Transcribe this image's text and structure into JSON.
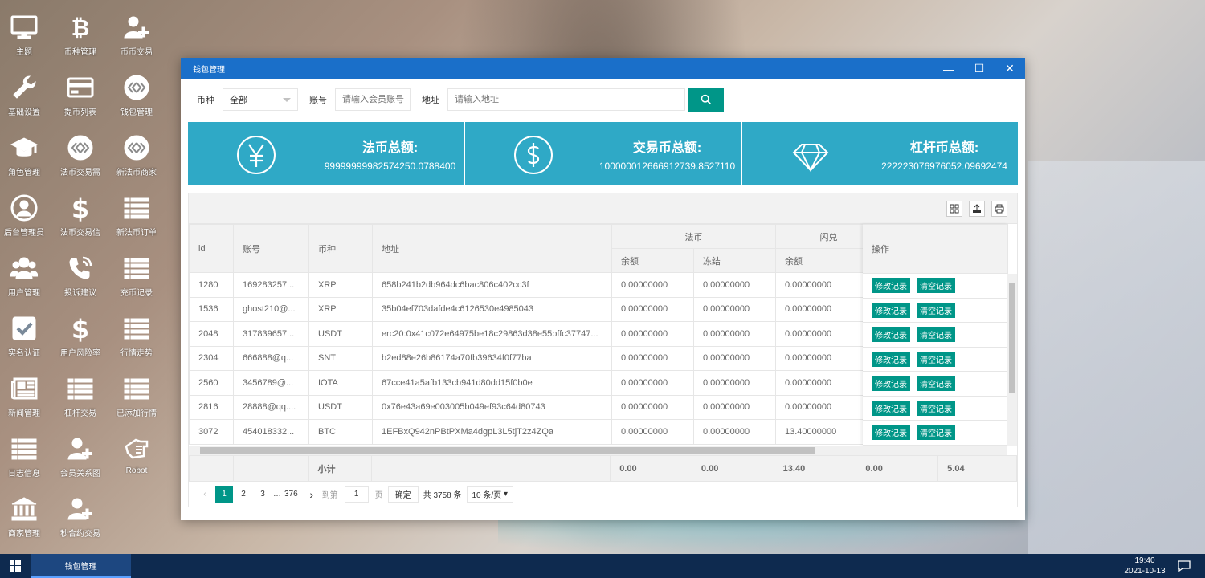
{
  "desktop_icons": [
    {
      "label": "主题",
      "icon": "monitor-icon"
    },
    {
      "label": "币种管理",
      "icon": "bitcoin-icon"
    },
    {
      "label": "币币交易",
      "icon": "add-user-icon"
    },
    {
      "label": "基础设置",
      "icon": "wrench-icon"
    },
    {
      "label": "提币列表",
      "icon": "card-icon"
    },
    {
      "label": "钱包管理",
      "icon": "wallet-icon"
    },
    {
      "label": "角色管理",
      "icon": "graduation-cap-icon"
    },
    {
      "label": "法币交易需",
      "icon": "wallet-icon"
    },
    {
      "label": "新法币商家",
      "icon": "wallet-icon"
    },
    {
      "label": "后台管理员",
      "icon": "user-circle-icon"
    },
    {
      "label": "法币交易信",
      "icon": "dollar-icon"
    },
    {
      "label": "新法币订单",
      "icon": "list-icon"
    },
    {
      "label": "用户管理",
      "icon": "users-icon"
    },
    {
      "label": "投诉建议",
      "icon": "phone-icon"
    },
    {
      "label": "充币记录",
      "icon": "list-icon"
    },
    {
      "label": "实名认证",
      "icon": "checkbox-icon"
    },
    {
      "label": "用户风险率",
      "icon": "dollar-icon"
    },
    {
      "label": "行情走势",
      "icon": "list-icon"
    },
    {
      "label": "新闻管理",
      "icon": "newspaper-icon"
    },
    {
      "label": "杠杆交易",
      "icon": "list-icon"
    },
    {
      "label": "已添加行情",
      "icon": "list-icon"
    },
    {
      "label": "日志信息",
      "icon": "list-icon"
    },
    {
      "label": "会员关系图",
      "icon": "add-user-icon"
    },
    {
      "label": "Robot",
      "icon": "hand-icon"
    },
    {
      "label": "商家管理",
      "icon": "bank-icon"
    },
    {
      "label": "秒合约交易",
      "icon": "add-user-icon"
    }
  ],
  "window": {
    "title": "钱包管理",
    "min": "—",
    "max": "☐",
    "close": "✕"
  },
  "filters": {
    "currency_label": "币种",
    "currency_value": "全部",
    "account_label": "账号",
    "account_placeholder": "请输入会员账号",
    "address_label": "地址",
    "address_placeholder": "请输入地址"
  },
  "cards": [
    {
      "title": "法币总额:",
      "value": "99999999982574250.0788400",
      "icon": "yen-icon"
    },
    {
      "title": "交易币总额:",
      "value": "100000012666912739.8527110",
      "icon": "dollar-circle-icon"
    },
    {
      "title": "杠杆币总额:",
      "value": "222223076976052.09692474",
      "icon": "diamond-icon"
    }
  ],
  "table": {
    "headers": {
      "id": "id",
      "account": "账号",
      "currency": "币种",
      "address": "地址",
      "fiat_group": "法币",
      "flash_group": "闪兑",
      "balance": "余额",
      "frozen": "冻结",
      "balance2": "余额",
      "op": "操作"
    },
    "rows": [
      {
        "id": "1280",
        "account": "169283257...",
        "currency": "XRP",
        "address": "658b241b2db964dc6bac806c402cc3f",
        "fiat_balance": "0.00000000",
        "fiat_frozen": "0.00000000",
        "flash_balance": "0.00000000"
      },
      {
        "id": "1536",
        "account": "ghost210@...",
        "currency": "XRP",
        "address": "35b04ef703dafde4c6126530e4985043",
        "fiat_balance": "0.00000000",
        "fiat_frozen": "0.00000000",
        "flash_balance": "0.00000000"
      },
      {
        "id": "2048",
        "account": "317839657...",
        "currency": "USDT",
        "address": "erc20:0x41c072e64975be18c29863d38e55bffc37747...",
        "fiat_balance": "0.00000000",
        "fiat_frozen": "0.00000000",
        "flash_balance": "0.00000000"
      },
      {
        "id": "2304",
        "account": "666888@q...",
        "currency": "SNT",
        "address": "b2ed88e26b86174a70fb39634f0f77ba",
        "fiat_balance": "0.00000000",
        "fiat_frozen": "0.00000000",
        "flash_balance": "0.00000000"
      },
      {
        "id": "2560",
        "account": "3456789@...",
        "currency": "IOTA",
        "address": "67cce41a5afb133cb941d80dd15f0b0e",
        "fiat_balance": "0.00000000",
        "fiat_frozen": "0.00000000",
        "flash_balance": "0.00000000"
      },
      {
        "id": "2816",
        "account": "28888@qq....",
        "currency": "USDT",
        "address": "0x76e43a69e003005b049ef93c64d80743",
        "fiat_balance": "0.00000000",
        "fiat_frozen": "0.00000000",
        "flash_balance": "0.00000000"
      },
      {
        "id": "3072",
        "account": "454018332...",
        "currency": "BTC",
        "address": "1EFBxQ942nPBtPXMa4dgpL3L5tjT2z4ZQa",
        "fiat_balance": "0.00000000",
        "fiat_frozen": "0.00000000",
        "flash_balance": "13.40000000"
      }
    ],
    "op_buttons": {
      "edit": "修改记录",
      "clear": "清空记录"
    },
    "total": {
      "label": "小计",
      "v1": "0.00",
      "v2": "0.00",
      "v3": "13.40",
      "v4": "0.00",
      "v5": "5.04"
    }
  },
  "pager": {
    "prev": "‹",
    "pages": [
      "1",
      "2",
      "3"
    ],
    "ellipsis": "…",
    "last": "376",
    "next": "›",
    "goto_label": "到第",
    "goto_value": "1",
    "page_unit": "页",
    "confirm": "确定",
    "total": "共 3758 条",
    "limit": "10 条/页"
  },
  "taskbar": {
    "item": "钱包管理",
    "time": "19:40",
    "date": "2021-10-13"
  }
}
